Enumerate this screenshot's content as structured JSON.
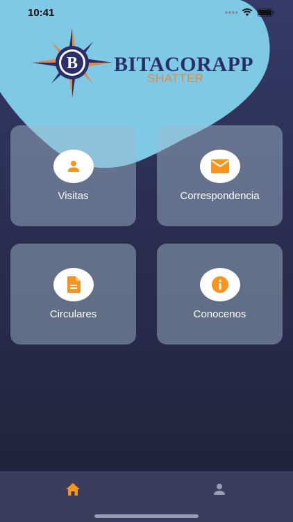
{
  "status_bar": {
    "time": "10:41"
  },
  "brand": {
    "title": "BITACORAPP",
    "subtitle": "SHATTER",
    "logo_letter": "B"
  },
  "menu": {
    "cards": [
      {
        "label": "Visitas",
        "icon": "person-icon"
      },
      {
        "label": "Correspondencia",
        "icon": "mail-icon"
      },
      {
        "label": "Circulares",
        "icon": "document-icon"
      },
      {
        "label": "Conocenos",
        "icon": "info-icon"
      }
    ]
  },
  "tab_bar": {
    "tabs": [
      {
        "icon": "home-icon",
        "active": true
      },
      {
        "icon": "person-icon",
        "active": false
      }
    ]
  },
  "colors": {
    "accent": "#f7941d",
    "card_bg": "#7f97ae",
    "tab_bar_bg": "#3b3d5e",
    "blob": "#7ec9e6"
  }
}
